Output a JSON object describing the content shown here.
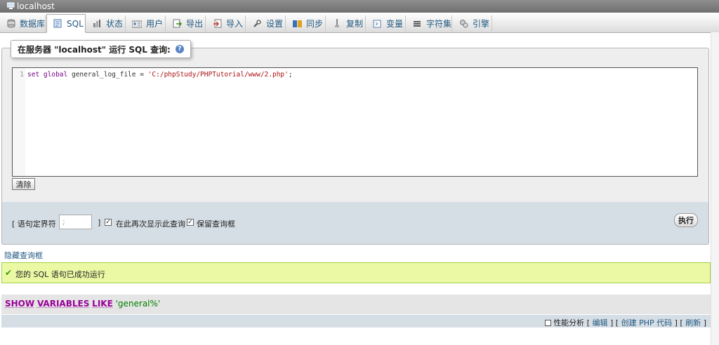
{
  "window": {
    "title": "localhost"
  },
  "tabs": [
    {
      "label": "数据库",
      "icon": "database-icon",
      "active": false
    },
    {
      "label": "SQL",
      "icon": "sql-icon",
      "active": true
    },
    {
      "label": "状态",
      "icon": "status-icon",
      "active": false
    },
    {
      "label": "用户",
      "icon": "users-icon",
      "active": false
    },
    {
      "label": "导出",
      "icon": "export-icon",
      "active": false
    },
    {
      "label": "导入",
      "icon": "import-icon",
      "active": false
    },
    {
      "label": "设置",
      "icon": "wrench-icon",
      "active": false
    },
    {
      "label": "同步",
      "icon": "sync-icon",
      "active": false
    },
    {
      "label": "复制",
      "icon": "replication-icon",
      "active": false
    },
    {
      "label": "变量",
      "icon": "variables-icon",
      "active": false
    },
    {
      "label": "字符集",
      "icon": "charset-icon",
      "active": false
    },
    {
      "label": "引擎",
      "icon": "engine-icon",
      "active": false
    }
  ],
  "query_box": {
    "legend": "在服务器 \"localhost\" 运行 SQL 查询:",
    "line_number": "1",
    "code": {
      "kw1": "set",
      "kw2": "global",
      "ident": "general_log_file",
      "op": "=",
      "str": "'C:/phpStudy/PHPTutorial/www/2.php'",
      "end": ";"
    },
    "clear_label": "清除"
  },
  "options": {
    "delimiter_label": "[ 语句定界符",
    "delimiter_value": ";",
    "close_bracket": "]",
    "show_again_label": "在此再次显示此查询",
    "show_again_checked": true,
    "keep_box_label": "保留查询框",
    "keep_box_checked": true,
    "go_label": "执行"
  },
  "hide_link": "隐藏查询框",
  "success": {
    "message": "您的 SQL 语句已成功运行"
  },
  "sql_shown": {
    "kw1": "SHOW",
    "kw2": "VARIABLES",
    "kw3": "LIKE",
    "str": "'general%'"
  },
  "tools": {
    "profiling_label": "性能分析",
    "profiling_checked": false,
    "bracket_open": "[",
    "edit_label": "编辑",
    "sep": "] [",
    "create_php_label": "创建 PHP 代码",
    "refresh_label": "刷新",
    "bracket_close": "]"
  },
  "colors": {
    "accent": "#235a81",
    "success_bg": "#ebf8a4",
    "keyword": "#990099"
  }
}
